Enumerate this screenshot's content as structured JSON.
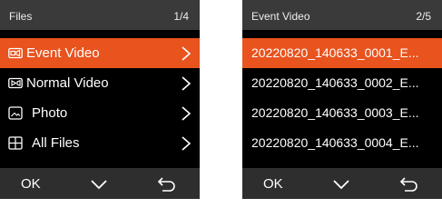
{
  "left_screen": {
    "header": {
      "title": "Files",
      "page": "1/4"
    },
    "items": [
      {
        "label": "Event Video",
        "icon": "event-video-icon",
        "selected": true
      },
      {
        "label": "Normal Video",
        "icon": "normal-video-icon",
        "selected": false
      },
      {
        "label": "Photo",
        "icon": "photo-icon",
        "selected": false
      },
      {
        "label": "All Files",
        "icon": "grid-icon",
        "selected": false
      }
    ],
    "footer": {
      "ok_label": "OK",
      "down_icon": "chevron-down-icon",
      "back_icon": "return-arrow-icon"
    }
  },
  "right_screen": {
    "header": {
      "title": "Event Video",
      "page": "2/5"
    },
    "items": [
      {
        "label": "20220820_140633_0001_E...",
        "selected": true
      },
      {
        "label": "20220820_140633_0002_E...",
        "selected": false
      },
      {
        "label": "20220820_140633_0003_E...",
        "selected": false
      },
      {
        "label": "20220820_140633_0004_E...",
        "selected": false
      }
    ],
    "footer": {
      "ok_label": "OK",
      "down_icon": "chevron-down-icon",
      "back_icon": "return-arrow-icon"
    }
  },
  "colors": {
    "accent": "#e8531e",
    "header_bg": "#3a3a3a",
    "footer_bg": "#2e2e2e",
    "screen_bg": "#000000"
  }
}
